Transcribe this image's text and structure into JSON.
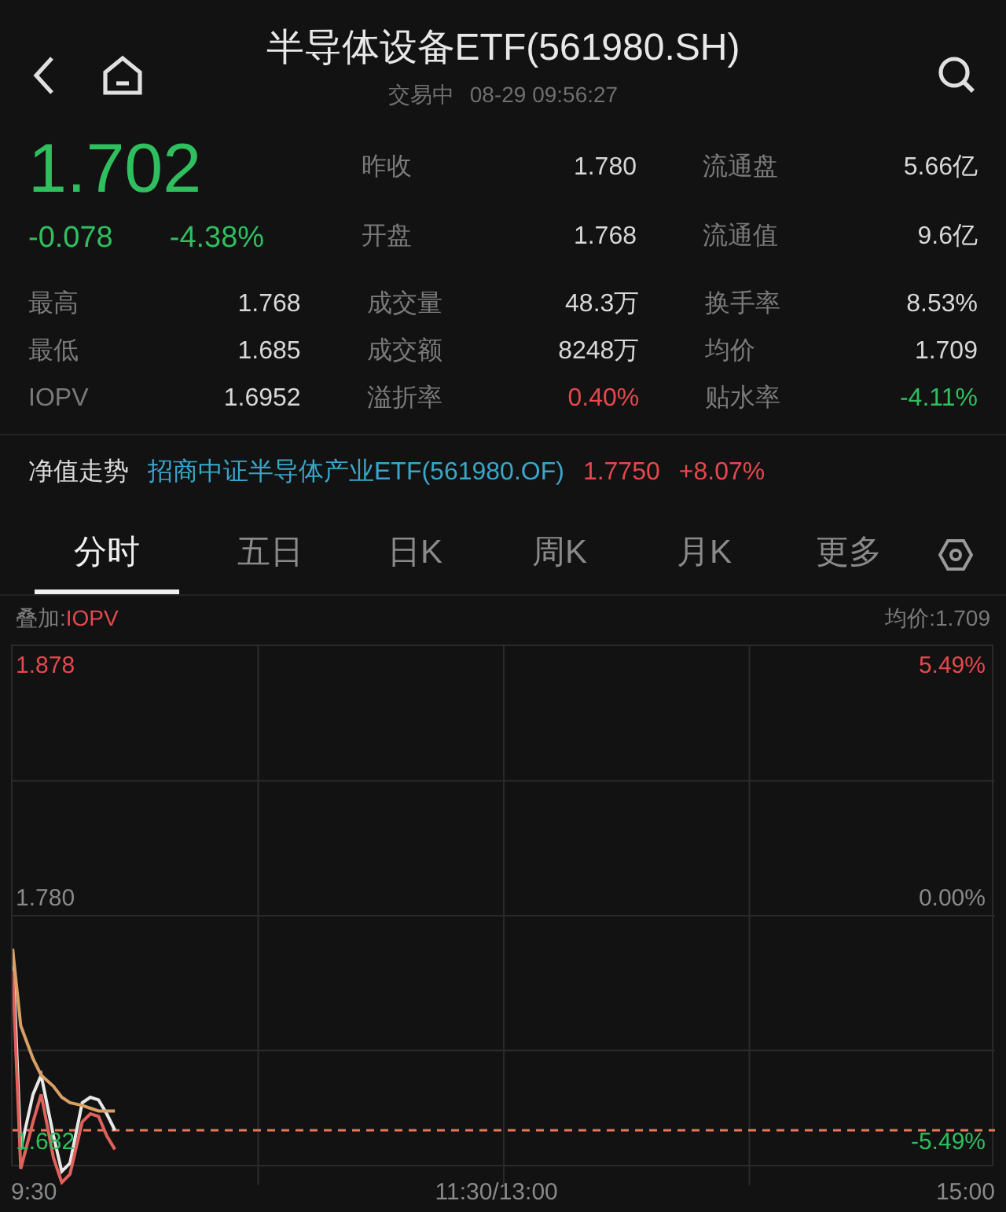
{
  "header": {
    "title": "半导体设备ETF(561980.SH)",
    "status": "交易中",
    "datetime": "08-29 09:56:27"
  },
  "quote": {
    "price": "1.702",
    "change": "-0.078",
    "change_pct": "-4.38%"
  },
  "top_stats": [
    {
      "label": "昨收",
      "value": "1.780"
    },
    {
      "label": "流通盘",
      "value": "5.66亿"
    },
    {
      "label": "开盘",
      "value": "1.768"
    },
    {
      "label": "流通值",
      "value": "9.6亿"
    }
  ],
  "stats": [
    {
      "label": "最高",
      "value": "1.768"
    },
    {
      "label": "成交量",
      "value": "48.3万"
    },
    {
      "label": "换手率",
      "value": "8.53%"
    },
    {
      "label": "最低",
      "value": "1.685"
    },
    {
      "label": "成交额",
      "value": "8248万"
    },
    {
      "label": "均价",
      "value": "1.709"
    },
    {
      "label": "IOPV",
      "value": "1.6952"
    },
    {
      "label": "溢折率",
      "value": "0.40%",
      "color": "#e5484d"
    },
    {
      "label": "贴水率",
      "value": "-4.11%",
      "color": "#2fbf5f"
    }
  ],
  "net_value": {
    "label": "净值走势",
    "fund": "招商中证半导体产业ETF(561980.OF)",
    "nav": "1.7750",
    "nav_change": "+8.07%"
  },
  "tabs": [
    {
      "label": "分时",
      "selected": true
    },
    {
      "label": "五日",
      "selected": false
    },
    {
      "label": "日K",
      "selected": false
    },
    {
      "label": "周K",
      "selected": false
    },
    {
      "label": "月K",
      "selected": false
    },
    {
      "label": "更多",
      "selected": false
    }
  ],
  "chart": {
    "overlay_prefix": "叠加:",
    "overlay": "IOPV",
    "average": "均价:1.709",
    "left_labels": [
      "1.878",
      "1.780",
      "1.682"
    ],
    "right_labels": [
      "5.49%",
      "0.00%",
      "-5.49%"
    ],
    "time_labels": [
      "9:30",
      "11:30/13:00",
      "15:00"
    ]
  }
}
